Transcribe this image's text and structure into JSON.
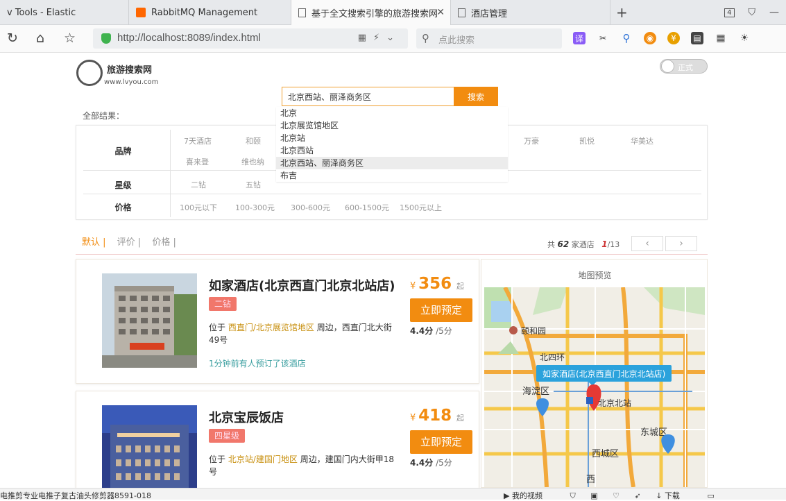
{
  "browser": {
    "tabs": [
      {
        "label": "v Tools - Elastic"
      },
      {
        "label": "RabbitMQ Management"
      },
      {
        "label": "基于全文搜索引擎的旅游搜索网"
      },
      {
        "label": "酒店管理"
      }
    ],
    "tab_badge": "4",
    "url": "http://localhost:8089/index.html",
    "search_placeholder": "点此搜索"
  },
  "site": {
    "name": "旅游搜索网",
    "domain": "www.lvyou.com",
    "mode_label": "正式"
  },
  "search": {
    "query": "北京西站、丽泽商务区",
    "button": "搜索",
    "suggestions": [
      "北京",
      "北京展览馆地区",
      "北京站",
      "北京西站",
      "北京西站、丽泽商务区",
      "布吉"
    ],
    "highlighted_index": 4
  },
  "filters": {
    "all_results_label": "全部结果：",
    "brand_label": "品牌",
    "brands": [
      "7天酒店",
      "和颐",
      "万豪",
      "凯悦",
      "华美达",
      "喜来登",
      "维也纳"
    ],
    "star_label": "星级",
    "stars": [
      "二钻",
      "五钻"
    ],
    "price_label": "价格",
    "prices": [
      "100元以下",
      "100-300元",
      "300-600元",
      "600-1500元",
      "1500元以上"
    ]
  },
  "sort": {
    "options": [
      "默认 |",
      "评价 |",
      "价格 |"
    ],
    "total_prefix": "共",
    "total": "62",
    "total_suffix": "家酒店",
    "page_current": "1",
    "page_total": "/13",
    "prev": "‹",
    "next": "›"
  },
  "hotels": [
    {
      "name": "如家酒店(北京西直门北京北站店)",
      "star": "二钻",
      "addr_prefix": "位于",
      "area": "西直门/北京展览馆地区",
      "addr_rest": "周边，西直门北大街49号",
      "recent": "1分钟前有人预订了该酒店",
      "currency": "¥",
      "price": "356",
      "price_suffix": "起",
      "book": "立即预定",
      "score": "4.4分",
      "score_max": "/5分"
    },
    {
      "name": "北京宝辰饭店",
      "star": "四星级",
      "addr_prefix": "位于",
      "area": "北京站/建国门地区",
      "addr_rest": "周边，建国门内大街甲18号",
      "recent": "",
      "currency": "¥",
      "price": "418",
      "price_suffix": "起",
      "book": "立即预定",
      "score": "4.4分",
      "score_max": "/5分"
    }
  ],
  "map": {
    "title": "地图预览",
    "popup": "如家酒店(北京西直门北京北站店)",
    "labels": {
      "yiheyuan": "颐和园",
      "beisihuan": "北四环",
      "haidian": "海淀区",
      "beijingbei": "北京北站",
      "dongcheng": "东城区",
      "xicheng": "西城区",
      "xi": "西"
    }
  },
  "statusbar": {
    "left": "电推剪专业电推子复古油头修剪器8591-018",
    "video": "我的视频",
    "download": "下载"
  },
  "colors": {
    "accent": "#f28c10",
    "star_badge": "#f1776b",
    "recent_text": "#3b9fa0",
    "area_text": "#c89010"
  }
}
